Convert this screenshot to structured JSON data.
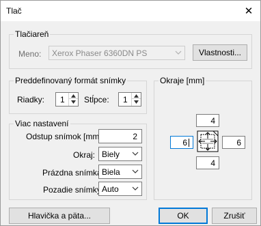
{
  "window": {
    "title": "Tlač",
    "close_glyph": "✕"
  },
  "printer": {
    "group_label": "Tlačiareň",
    "name_label": "Meno:",
    "name_value": "Xerox Phaser 6360DN PS",
    "properties_button": "Vlastnosti..."
  },
  "predefined": {
    "group_label": "Preddefinovaný formát snímky",
    "rows_label": "Riadky:",
    "rows_value": "1",
    "cols_label": "Stĺpce:",
    "cols_value": "1"
  },
  "more": {
    "group_label": "Viac nastavení",
    "spacing_label": "Odstup snímok [mm]:",
    "spacing_value": "2",
    "border_label": "Okraj:",
    "border_value": "Biely",
    "empty_label": "Prázdna snímka:",
    "empty_value": "Biela",
    "background_label": "Pozadie snímky:",
    "background_value": "Auto"
  },
  "margins": {
    "group_label": "Okraje [mm]",
    "top": "4",
    "left": "6",
    "right": "6",
    "bottom": "4"
  },
  "footer": {
    "header_footer_button": "Hlavička a päta...",
    "ok_button": "OK",
    "cancel_button": "Zrušiť"
  },
  "colors": {
    "focus": "#0078d7",
    "dialog_bg": "#f0f0f0",
    "border": "#adadad"
  }
}
